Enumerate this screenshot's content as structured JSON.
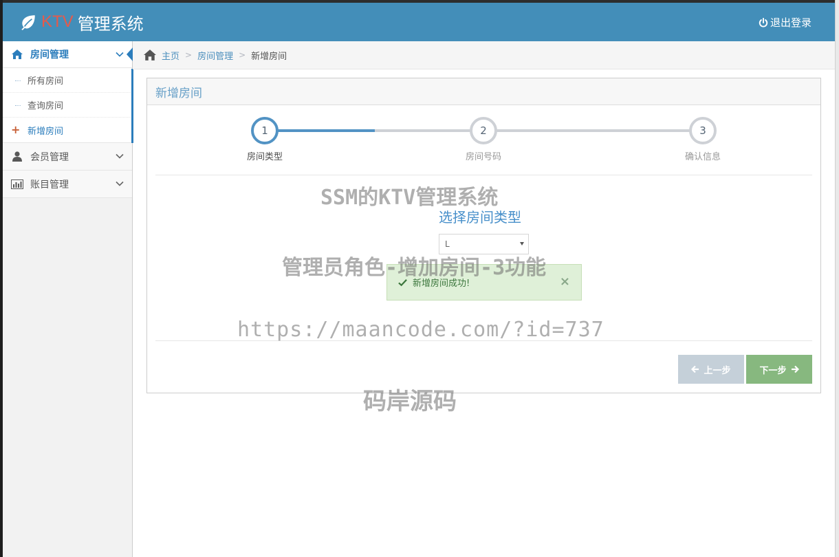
{
  "header": {
    "brand_prefix": "KTV",
    "brand_suffix": "管理系统",
    "logout_label": "退出登录"
  },
  "sidebar": {
    "room_mgmt": "房间管理",
    "sub_items": [
      "所有房间",
      "查询房间",
      "新增房间"
    ],
    "member_mgmt": "会员管理",
    "bill_mgmt": "账目管理"
  },
  "breadcrumb": {
    "home": "主页",
    "section": "房间管理",
    "current": "新增房间"
  },
  "panel": {
    "title": "新增房间"
  },
  "wizard": {
    "steps": [
      {
        "number": "1",
        "label": "房间类型",
        "active": true
      },
      {
        "number": "2",
        "label": "房间号码",
        "active": false
      },
      {
        "number": "3",
        "label": "确认信息",
        "active": false
      }
    ],
    "form_title": "选择房间类型",
    "selected_type": "L",
    "alert_message": "新增房间成功!",
    "alert_close": "×",
    "prev_label": "上一步",
    "next_label": "下一步"
  },
  "watermarks": {
    "line1": "SSM的KTV管理系统",
    "line2": "管理员角色-增加房间-3功能",
    "line3": "https://maancode.com/?id=737",
    "line4": "码岸源码"
  },
  "colors": {
    "navbar": "#438eb9",
    "accent": "#2b7dbc",
    "success_bg": "#dff0d8",
    "next_button": "#87b87f",
    "prev_button": "#c5d0d9"
  }
}
